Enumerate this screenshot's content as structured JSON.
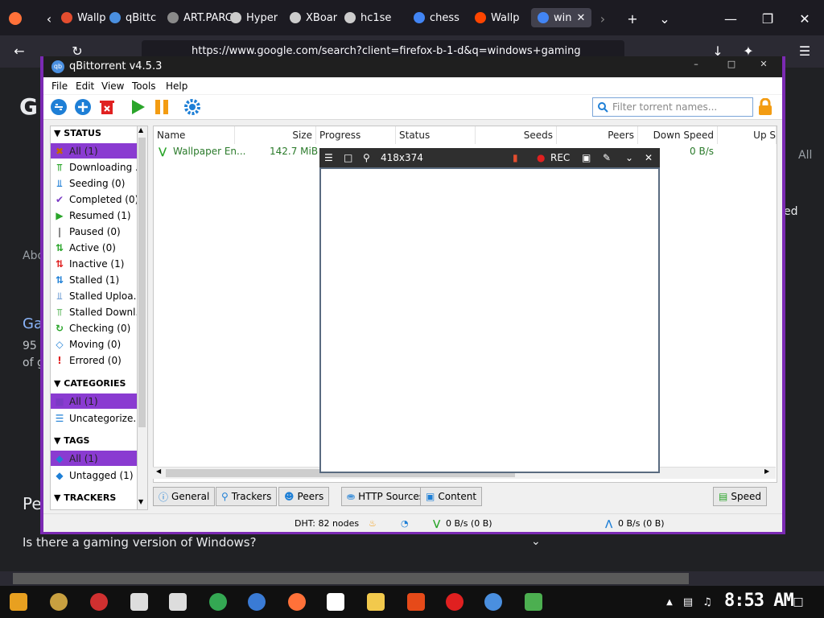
{
  "firefox": {
    "tabs": [
      {
        "label": "Wallp",
        "color": "#e34d2f"
      },
      {
        "label": "qBittc",
        "color": "#4a8fdf"
      },
      {
        "label": "ART.PARC",
        "color": "#8a8a8a"
      },
      {
        "label": "Hyper",
        "color": "#cccccc"
      },
      {
        "label": "XBoar",
        "color": "#cccccc"
      },
      {
        "label": "hc1se",
        "color": "#cccccc"
      },
      {
        "label": "chess",
        "color": "#4285f4"
      },
      {
        "label": "Wallp",
        "color": "#ff4500"
      },
      {
        "label": "win",
        "color": "#4285f4"
      }
    ],
    "url": "https://www.google.com/search?client=firefox-b-1-d&q=windows+gaming",
    "page_snippets": {
      "letter": "G",
      "result_title": "Ga",
      "result_line1": "95",
      "result_line2": "of g",
      "about": "Abo",
      "people": "Pe",
      "question": "Is there a gaming version of Windows?",
      "right1": "All",
      "right2": "ed"
    }
  },
  "qbittorrent": {
    "title": "qBittorrent v4.5.3",
    "logo": "qb",
    "menu": [
      "File",
      "Edit",
      "View",
      "Tools",
      "Help"
    ],
    "search_placeholder": "Filter torrent names...",
    "sidebar": {
      "status_heading": "STATUS",
      "status_items": [
        {
          "label": "All (1)",
          "icon": "all-icon",
          "selected": true
        },
        {
          "label": "Downloading ...",
          "icon": "downloading-icon"
        },
        {
          "label": "Seeding (0)",
          "icon": "seeding-icon"
        },
        {
          "label": "Completed (0)",
          "icon": "completed-icon"
        },
        {
          "label": "Resumed (1)",
          "icon": "resumed-icon"
        },
        {
          "label": "Paused (0)",
          "icon": "paused-icon"
        },
        {
          "label": "Active (0)",
          "icon": "active-icon"
        },
        {
          "label": "Inactive (1)",
          "icon": "inactive-icon"
        },
        {
          "label": "Stalled (1)",
          "icon": "stalled-icon"
        },
        {
          "label": "Stalled Uploa...",
          "icon": "stalled-upload-icon"
        },
        {
          "label": "Stalled Downl...",
          "icon": "stalled-download-icon"
        },
        {
          "label": "Checking (0)",
          "icon": "checking-icon"
        },
        {
          "label": "Moving (0)",
          "icon": "moving-icon"
        },
        {
          "label": "Errored (0)",
          "icon": "errored-icon"
        }
      ],
      "categories_heading": "CATEGORIES",
      "category_items": [
        {
          "label": "All (1)",
          "selected": true
        },
        {
          "label": "Uncategorize..."
        }
      ],
      "tags_heading": "TAGS",
      "tag_items": [
        {
          "label": "All (1)",
          "selected": true
        },
        {
          "label": "Untagged (1)"
        }
      ],
      "trackers_heading": "TRACKERS"
    },
    "columns": [
      "Name",
      "Size",
      "Progress",
      "Status",
      "Seeds",
      "Peers",
      "Down Speed",
      "Up S"
    ],
    "torrents": [
      {
        "name": "Wallpaper En...",
        "size": "142.7 MiB",
        "down_speed": "0 B/s"
      }
    ],
    "bottom_tabs": [
      "General",
      "Trackers",
      "Peers",
      "HTTP Sources",
      "Content"
    ],
    "speed_button": "Speed",
    "statusbar": {
      "dht": "DHT: 82 nodes",
      "down": "0 B/s (0 B)",
      "up": "0 B/s (0 B)"
    }
  },
  "capture_tool": {
    "size": "418x374",
    "rec_label": "REC"
  },
  "taskbar": {
    "clock": "8:53 AM"
  }
}
